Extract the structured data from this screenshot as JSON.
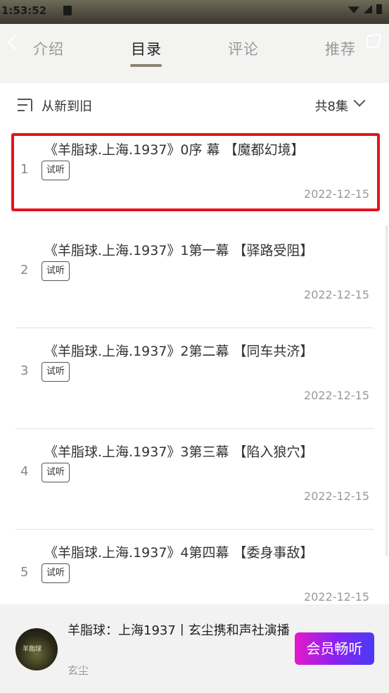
{
  "status_bar": {
    "time": "1:53:52"
  },
  "tabs": [
    {
      "label": "介绍"
    },
    {
      "label": "目录"
    },
    {
      "label": "评论"
    },
    {
      "label": "推荐"
    }
  ],
  "active_tab": "目录",
  "sort": {
    "label": "从新到旧",
    "count": "共8集"
  },
  "episodes": [
    {
      "index": "1",
      "title": "《羊脂球.上海.1937》0序 幕 【魔都幻境】",
      "badge": "试听",
      "date": "2022-12-15",
      "highlighted": true
    },
    {
      "index": "2",
      "title": "《羊脂球.上海.1937》1第一幕 【驿路受阻】",
      "badge": "试听",
      "date": "2022-12-15"
    },
    {
      "index": "3",
      "title": "《羊脂球.上海.1937》2第二幕 【同车共济】",
      "badge": "试听",
      "date": "2022-12-15"
    },
    {
      "index": "4",
      "title": "《羊脂球.上海.1937》3第三幕 【陷入狼穴】",
      "badge": "试听",
      "date": "2022-12-15"
    },
    {
      "index": "5",
      "title": "《羊脂球.上海.1937》4第四幕 【委身事敌】",
      "badge": "试听",
      "date": "2022-12-15"
    }
  ],
  "player": {
    "title": "羊脂球：上海1937丨玄尘携和声社演播",
    "author": "玄尘",
    "cover_text": "羊脂球",
    "vip_button": "会员畅听"
  },
  "colors": {
    "highlight": "#e4141b",
    "accent_start": "#e419c8",
    "accent_end": "#4a3af6",
    "tab_underline": "#8c8474"
  }
}
